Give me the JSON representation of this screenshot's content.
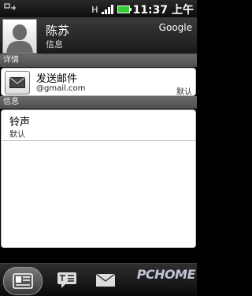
{
  "status": {
    "usb_icon": "usb-icon",
    "network": "H",
    "time": "11:37 上午"
  },
  "header": {
    "name": "陈苏",
    "subtitle": "信息",
    "account": "Google"
  },
  "sections": {
    "details": "详情",
    "info": "信息"
  },
  "email": {
    "title": "发送邮件",
    "address": "@gmail.com",
    "type": "默认"
  },
  "ringtone": {
    "title": "铃声",
    "value": "默认"
  },
  "watermark": "PCHOME"
}
